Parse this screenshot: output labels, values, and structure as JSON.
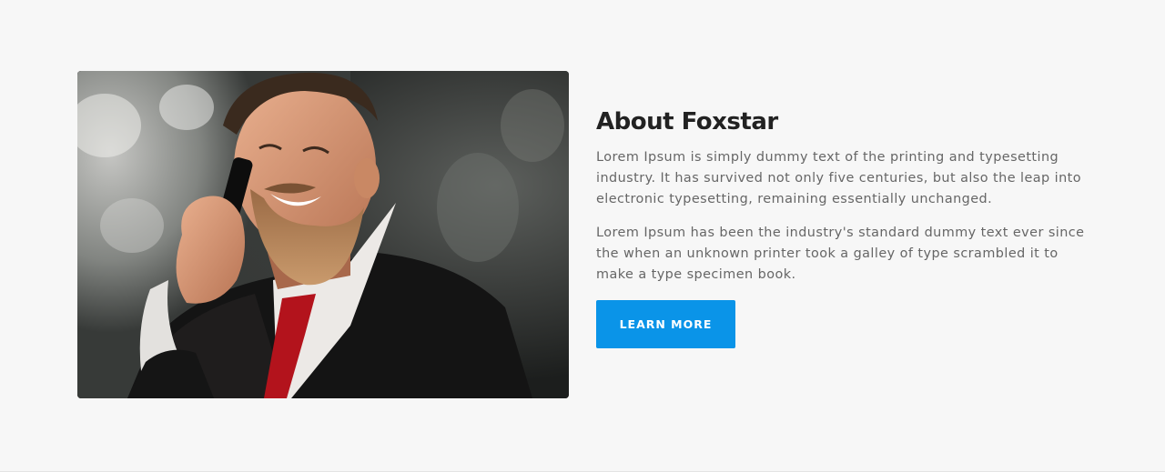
{
  "about": {
    "title": "About Foxstar",
    "paragraphs": [
      "Lorem Ipsum is simply dummy text of the printing and typesetting industry. It has survived not only five centuries, but also the leap into electronic typesetting, remaining essentially unchanged.",
      "Lorem Ipsum has been the industry's standard dummy text ever since the when an unknown printer took a galley of type scrambled it to make a type specimen book."
    ],
    "button_label": "LEARN MORE",
    "image": "photo of a bearded man in a suit talking on a phone"
  },
  "colors": {
    "background": "#f7f7f7",
    "title": "#222222",
    "body_text": "#666666",
    "button": "#0a94e8",
    "button_text": "#ffffff"
  }
}
